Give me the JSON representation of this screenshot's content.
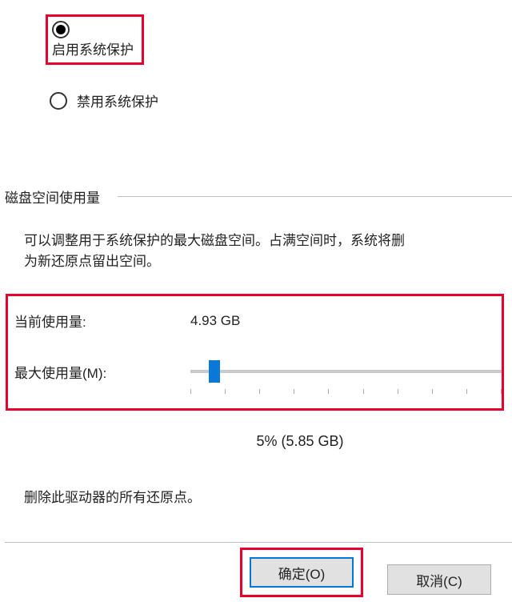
{
  "protection": {
    "enable_label": "启用系统保护",
    "disable_label": "禁用系统保护"
  },
  "section": {
    "disk_usage_title": "磁盘空间使用量"
  },
  "description": {
    "line1": "可以调整用于系统保护的最大磁盘空间。占满空间时，系统将删",
    "line2": "为新还原点留出空间。"
  },
  "usage": {
    "current_label": "当前使用量:",
    "current_value": "4.93 GB",
    "max_label": "最大使用量(M):",
    "percent_text": "5% (5.85 GB)"
  },
  "delete_text": "删除此驱动器的所有还原点。",
  "buttons": {
    "ok": "确定(O)",
    "cancel": "取消(C)"
  }
}
